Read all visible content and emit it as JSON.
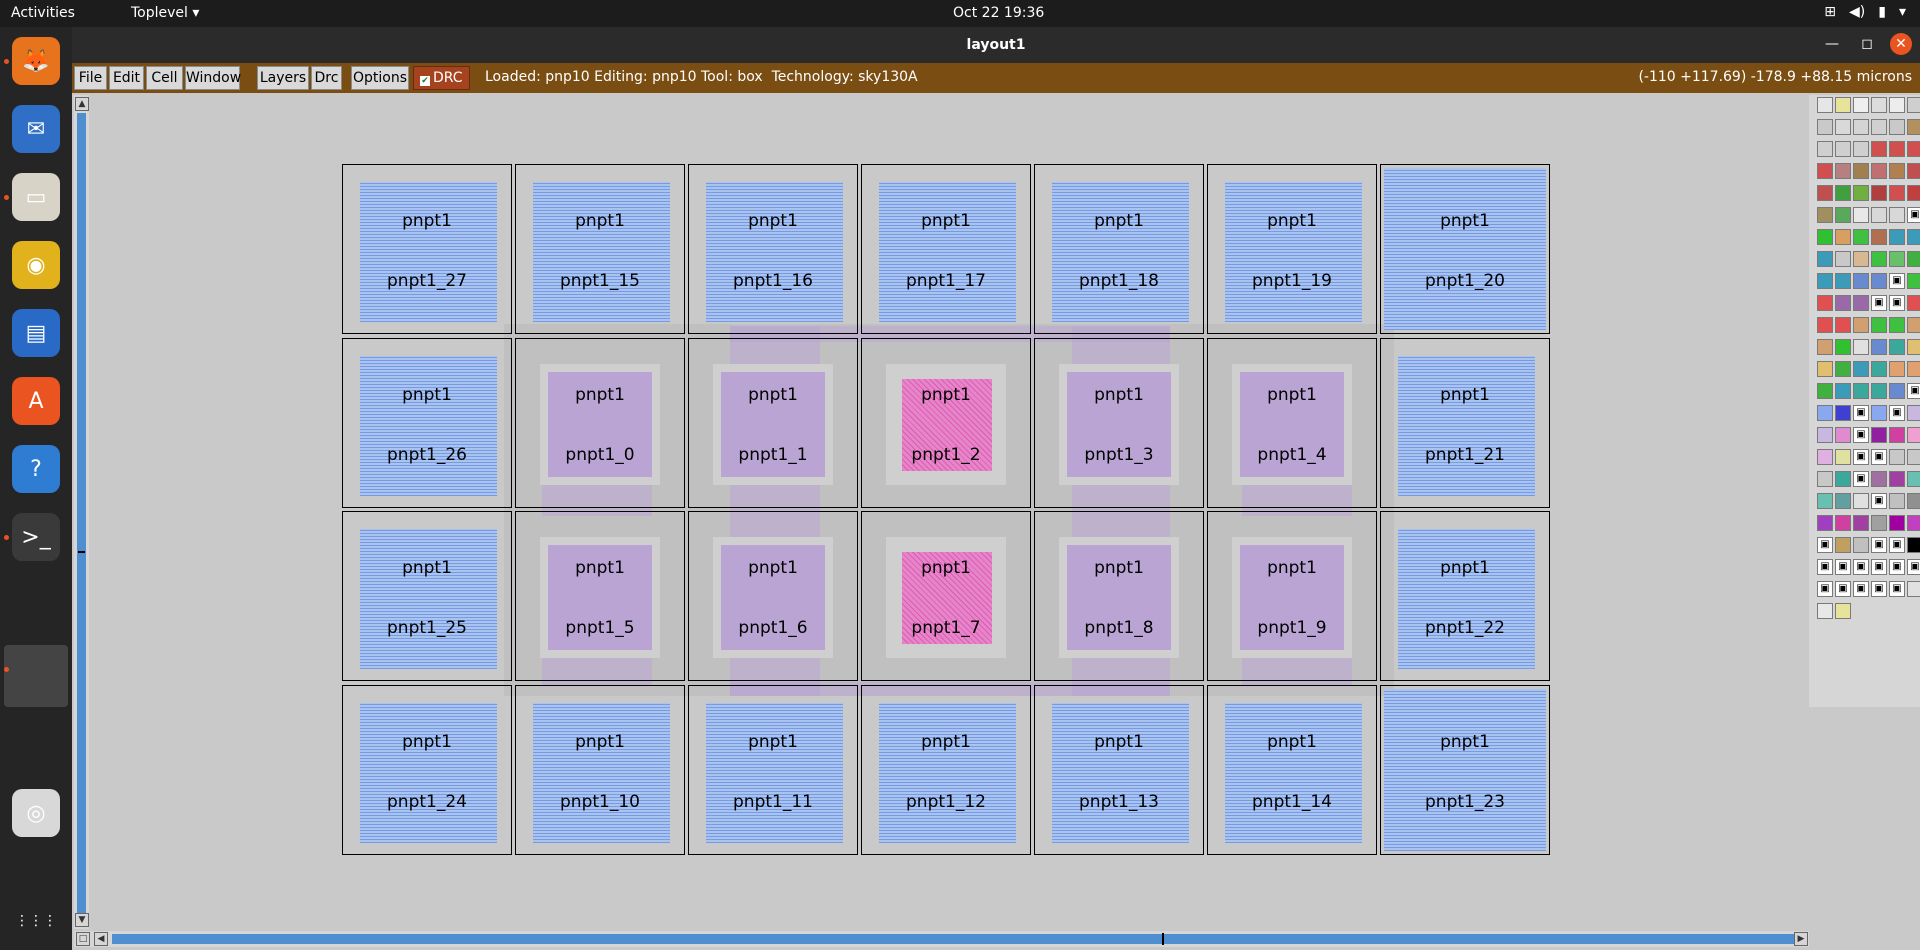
{
  "topbar": {
    "activities": "Activities",
    "app_menu": "Toplevel ▾",
    "clock": "Oct 22  19:36",
    "tray_icons": [
      "network-icon",
      "volume-icon",
      "battery-icon",
      "power-menu-icon"
    ]
  },
  "dock": {
    "items": [
      {
        "name": "firefox-icon",
        "glyph": "🦊",
        "color": "#e8731d"
      },
      {
        "name": "thunderbird-icon",
        "glyph": "✉",
        "color": "#2f6fc5"
      },
      {
        "name": "files-icon",
        "glyph": "▭",
        "color": "#d8d3c7"
      },
      {
        "name": "rhythmbox-icon",
        "glyph": "◉",
        "color": "#e2b21c"
      },
      {
        "name": "writer-icon",
        "glyph": "▤",
        "color": "#2a6ac7"
      },
      {
        "name": "software-icon",
        "glyph": "A",
        "color": "#e95420"
      },
      {
        "name": "help-icon",
        "glyph": "?",
        "color": "#2e7dd2"
      },
      {
        "name": "terminal-icon",
        "glyph": ">_",
        "color": "#3a3a3a"
      },
      {
        "name": "active-window-icon",
        "glyph": "",
        "color": "#444"
      },
      {
        "name": "dvd-icon",
        "glyph": "◎",
        "color": "#d8d8d8"
      },
      {
        "name": "show-apps-icon",
        "glyph": "⋮⋮⋮",
        "color": "transparent"
      }
    ]
  },
  "window": {
    "title": "layout1",
    "minimize": "—",
    "maximize": "◻",
    "close": "✕"
  },
  "menubar": {
    "items": [
      "File",
      "Edit",
      "Cell",
      "Window",
      "Layers",
      "Drc",
      "Options"
    ],
    "drc_toggle": "DRC",
    "status": "Loaded: pnp10 Editing: pnp10 Tool: box  Technology: sky130A",
    "coords": "(-110 +117.69) -178.9 +88.15 microns"
  },
  "layout": {
    "cell_type": "pnpt1",
    "rows": [
      [
        {
          "id": "pnpt1_27",
          "kind": "outer"
        },
        {
          "id": "pnpt1_15",
          "kind": "outer"
        },
        {
          "id": "pnpt1_16",
          "kind": "outer"
        },
        {
          "id": "pnpt1_17",
          "kind": "outer"
        },
        {
          "id": "pnpt1_18",
          "kind": "outer"
        },
        {
          "id": "pnpt1_19",
          "kind": "outer"
        },
        {
          "id": "pnpt1_20",
          "kind": "corner"
        }
      ],
      [
        {
          "id": "pnpt1_26",
          "kind": "outer"
        },
        {
          "id": "pnpt1_0",
          "kind": "inner"
        },
        {
          "id": "pnpt1_1",
          "kind": "inner"
        },
        {
          "id": "pnpt1_2",
          "kind": "pink"
        },
        {
          "id": "pnpt1_3",
          "kind": "inner"
        },
        {
          "id": "pnpt1_4",
          "kind": "inner"
        },
        {
          "id": "pnpt1_21",
          "kind": "outer"
        }
      ],
      [
        {
          "id": "pnpt1_25",
          "kind": "outer"
        },
        {
          "id": "pnpt1_5",
          "kind": "inner"
        },
        {
          "id": "pnpt1_6",
          "kind": "inner"
        },
        {
          "id": "pnpt1_7",
          "kind": "pink"
        },
        {
          "id": "pnpt1_8",
          "kind": "inner"
        },
        {
          "id": "pnpt1_9",
          "kind": "inner"
        },
        {
          "id": "pnpt1_22",
          "kind": "outer"
        }
      ],
      [
        {
          "id": "pnpt1_24",
          "kind": "outer"
        },
        {
          "id": "pnpt1_10",
          "kind": "outer"
        },
        {
          "id": "pnpt1_11",
          "kind": "outer"
        },
        {
          "id": "pnpt1_12",
          "kind": "outer"
        },
        {
          "id": "pnpt1_13",
          "kind": "outer"
        },
        {
          "id": "pnpt1_14",
          "kind": "outer"
        },
        {
          "id": "pnpt1_23",
          "kind": "corner"
        }
      ]
    ]
  },
  "palette": {
    "swatch_colors": [
      "#e6e6e6",
      "#e8e39a",
      "#efefef",
      "#dcdcdc",
      "#ededed",
      "#cfcfcf",
      "#c9c9c9",
      "#d9d9d9",
      "#d4d4d4",
      "#d0d0d0",
      "#c9c9c9",
      "#b39060",
      "#cfcfcf",
      "#cfcfcf",
      "#cfcfcf",
      "#d05050",
      "#d05050",
      "#d05050",
      "#d05050",
      "#b78080",
      "#a08050",
      "#c07070",
      "#b08050",
      "#c05050",
      "#c05050",
      "#40a040",
      "#70b040",
      "#b04040",
      "#d05050",
      "#c04040",
      "#a09060",
      "#5aa85a",
      "#e8e8e8",
      "#d8d8d8",
      "#d8d8d8",
      "#ffffff",
      "#30c030",
      "#d8a060",
      "#40c040",
      "#b07050",
      "#3b9bb8",
      "#3b9bb8",
      "#3b9bb8",
      "#c8c8c8",
      "#d8b890",
      "#40c040",
      "#6ac06a",
      "#40b040",
      "#3b9bb8",
      "#3b9bb8",
      "#6a8ad0",
      "#6a8ad0",
      "#ffffff",
      "#40c040",
      "#e05050",
      "#9a6aa8",
      "#9a6aa8",
      "#ffffff",
      "#ffffff",
      "#e05050",
      "#e05050",
      "#e05050",
      "#d0a070",
      "#40c040",
      "#40c040",
      "#d0a070",
      "#d0a070",
      "#30c030",
      "#e0e0e0",
      "#6a8ad0",
      "#3ba89b",
      "#e0c070",
      "#e0c070",
      "#40b040",
      "#3b9bb8",
      "#3ba89b",
      "#e0a070",
      "#e0a070",
      "#40b040",
      "#3b9bb8",
      "#3ba89b",
      "#3ba89b",
      "#6a8ad0",
      "#ffffff",
      "#8aa8f0",
      "#4040d0",
      "#ffffff",
      "#8aa8f0",
      "#ffffff",
      "#c8b8e0",
      "#c8b8e0",
      "#e08ad0",
      "#ffffff",
      "#9020a0",
      "#d040a0",
      "#f0a0d0",
      "#e0b0e0",
      "#e0e0a0",
      "#ffffff",
      "#ffffff",
      "#c8c8c8",
      "#c8c8c8",
      "#c8c8c8",
      "#3ba89b",
      "#ffffff",
      "#a070a0",
      "#a040a0",
      "#6ac0b0",
      "#6ac0b0",
      "#60a0a0",
      "#e0e0e0",
      "#ffffff",
      "#c0c0c0",
      "#909090",
      "#a040c0",
      "#d040a0",
      "#a040a0",
      "#a0a0a0",
      "#a000a0",
      "#c040c0",
      "#ffffff",
      "#c0a060",
      "#c0c0c0",
      "#ffffff",
      "#ffffff",
      "#000000",
      "#ffffff",
      "#ffffff",
      "#ffffff",
      "#ffffff",
      "#ffffff",
      "#ffffff",
      "#ffffff",
      "#ffffff",
      "#ffffff",
      "#ffffff",
      "#ffffff",
      "#e0e0e0",
      "#e8e8e8",
      "#e8e39a"
    ],
    "lock_glyph": "🔒"
  }
}
